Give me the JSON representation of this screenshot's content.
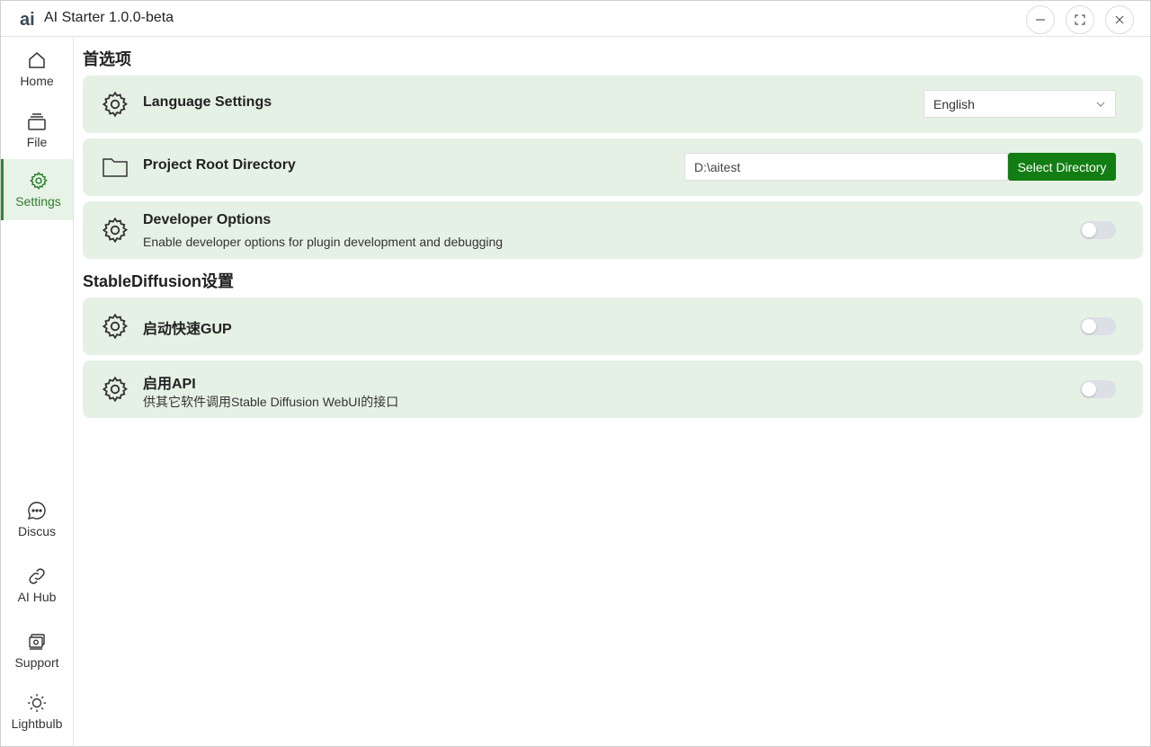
{
  "window": {
    "title": "AI Starter 1.0.0-beta"
  },
  "sidebar": {
    "items": [
      {
        "label": "Home",
        "icon": "home-icon"
      },
      {
        "label": "File",
        "icon": "file-icon"
      },
      {
        "label": "Settings",
        "icon": "gear-icon",
        "active": true
      },
      {
        "label": "Discus",
        "icon": "chat-icon"
      },
      {
        "label": "AI Hub",
        "icon": "link-icon"
      },
      {
        "label": "Support",
        "icon": "support-icon"
      },
      {
        "label": "Lightbulb",
        "icon": "sun-icon"
      }
    ]
  },
  "sections": {
    "preferences_title": "首选项",
    "sd_title": "StableDiffusion设置"
  },
  "settings": {
    "language": {
      "title": "Language Settings",
      "value": "English"
    },
    "project_root": {
      "title": "Project Root Directory",
      "value": "D:\\aitest",
      "button": "Select Directory"
    },
    "developer": {
      "title": "Developer Options",
      "desc": "Enable developer options for plugin development and debugging",
      "enabled": false
    },
    "fast_gpu": {
      "title": "启动快速GUP",
      "enabled": false
    },
    "api": {
      "title": "启用API",
      "desc": "供其它软件调用Stable Diffusion WebUI的接口",
      "enabled": false
    }
  },
  "colors": {
    "accent": "#127d12",
    "card_bg": "#e6f1e6",
    "active_nav_bg": "#e8f3e8"
  }
}
